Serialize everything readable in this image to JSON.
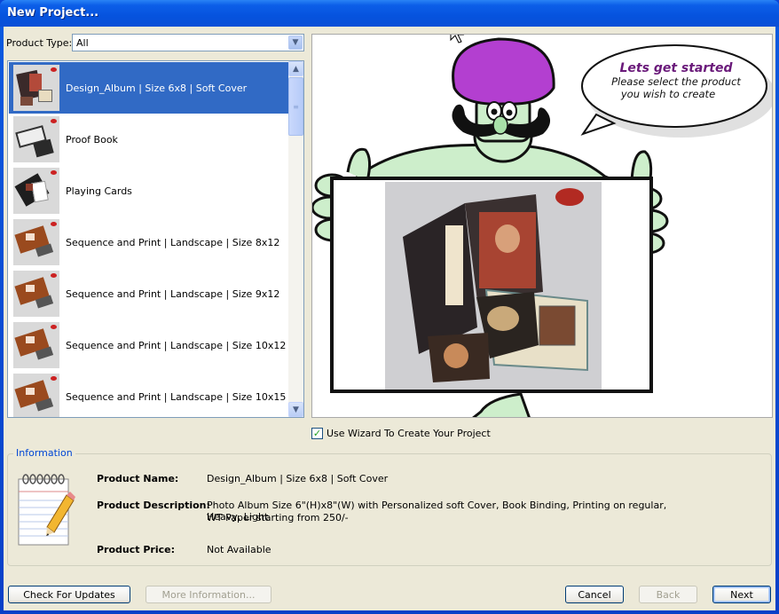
{
  "window": {
    "title": "New Project..."
  },
  "product_type": {
    "label": "Product Type:",
    "value": "All"
  },
  "product_list": {
    "items": [
      {
        "label": "Design_Album | Size 6x8 | Soft Cover",
        "selected": true
      },
      {
        "label": "Proof Book",
        "selected": false
      },
      {
        "label": "Playing Cards",
        "selected": false
      },
      {
        "label": "Sequence and Print | Landscape | Size 8x12",
        "selected": false
      },
      {
        "label": "Sequence and Print | Landscape | Size 9x12",
        "selected": false
      },
      {
        "label": "Sequence and Print | Landscape | Size 10x12",
        "selected": false
      },
      {
        "label": "Sequence and Print | Landscape | Size 10x15",
        "selected": false
      }
    ]
  },
  "preview": {
    "bubble_title": "Lets get started",
    "bubble_line1": "Please select the product",
    "bubble_line2": "you wish to create",
    "colors": {
      "turban": "#b33fd0",
      "skin": "#cdeecb",
      "bubble_title": "#6a1a7a"
    }
  },
  "wizard_checkbox": {
    "label": "Use Wizard To Create Your Project",
    "checked": true
  },
  "information": {
    "legend": "Information",
    "product_name_label": "Product Name:",
    "product_name": "Design_Album | Size 6x8 | Soft Cover",
    "product_description_label": "Product Description:",
    "product_description_line1": "Photo Album Size 6\"(H)x8\"(W) with Personalized soft Cover, Book Binding, Printing on regular, Heavy, Light",
    "product_description_line2": "WT Paper starting from 250/-",
    "product_price_label": "Product Price:",
    "product_price": "Not Available"
  },
  "buttons": {
    "check_updates": "Check For Updates",
    "more_info": "More Information...",
    "cancel": "Cancel",
    "back": "Back",
    "next": "Next"
  }
}
